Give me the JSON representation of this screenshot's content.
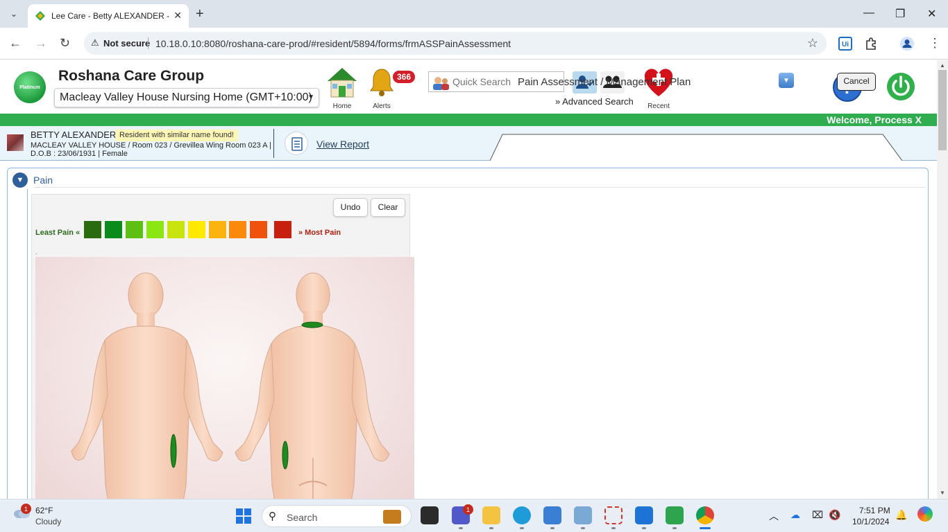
{
  "browser": {
    "tab_title": "Lee Care - Betty ALEXANDER - P",
    "security_label": "Not secure",
    "url": "10.18.0.10:8080/roshana-care-prod/#resident/5894/forms/frmASSPainAssessment"
  },
  "header": {
    "org_name": "Roshana Care Group",
    "logo_text": "Platinum",
    "facility": "Macleay Valley House Nursing Home (GMT+10:00)",
    "home_label": "Home",
    "alerts_label": "Alerts",
    "alerts_count": "366",
    "search_placeholder": "Quick Search",
    "advanced_search": "» Advanced Search",
    "recent_label": "Recent",
    "welcome": "Welcome, Process X"
  },
  "resident": {
    "name": "BETTY ALEXANDER",
    "warning": "Resident with similar name found!",
    "address_line": "MACLEAY VALLEY HOUSE / Room 023 / Grevillea Wing Room 023 A | D.O.B : 23/06/1931 | Female",
    "view_report": "View Report"
  },
  "form": {
    "title": "Pain Assessment / Management Plan",
    "cancel_label": "Cancel",
    "section_title": "Pain",
    "undo_label": "Undo",
    "clear_label": "Clear",
    "least_pain_label": "Least Pain «",
    "most_pain_label": "» Most Pain",
    "dot_text": ".",
    "pain_scale_colors": [
      "#2a6b10",
      "#0b8b1b",
      "#5cbf12",
      "#8ce614",
      "#c9e30f",
      "#ffe900",
      "#fbb40d",
      "#fb8a0b",
      "#f0520e",
      "#c8200f"
    ],
    "marked_color": "#1f8a1f"
  },
  "taskbar": {
    "weather_temp": "62°F",
    "weather_desc": "Cloudy",
    "weather_badge": "1",
    "search_label": "Search",
    "teams_badge": "1",
    "time": "7:51 PM",
    "date": "10/1/2024"
  }
}
